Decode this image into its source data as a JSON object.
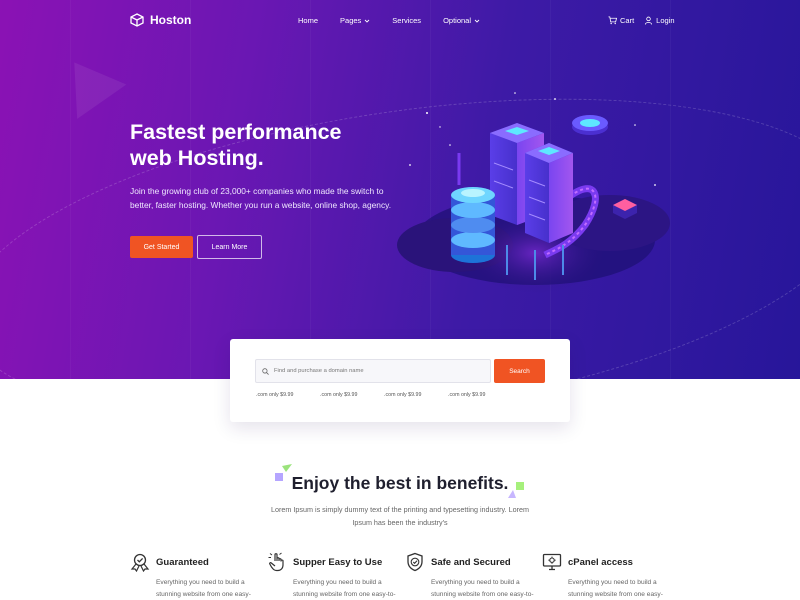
{
  "nav": {
    "logo": "Hoston",
    "menu": {
      "home": "Home",
      "pages": "Pages",
      "services": "Services",
      "optional": "Optional"
    },
    "cart": "Cart",
    "login": "Login"
  },
  "hero": {
    "title_line1": "Fastest performance",
    "title_line2": "web Hosting.",
    "subtitle": "Join the growing club of 23,000+ companies who made the switch to better, faster hosting. Whether you run a website, online shop, agency.",
    "primary_button": "Get Started",
    "secondary_button": "Learn More"
  },
  "search": {
    "placeholder": "Find and purchase a domain name",
    "button": "Search",
    "prices": [
      ".com only $9.99",
      ".com only $9.99",
      ".com only $9.99",
      ".com only $9.99"
    ]
  },
  "benefits": {
    "title": "Enjoy the best in benefits.",
    "subtitle": "Lorem Ipsum is simply dummy text of the printing and typesetting industry. Lorem Ipsum has been the industry's",
    "features": [
      {
        "title": "Guaranteed",
        "icon": "award-ribbon-icon",
        "desc": "Everything you need to build a stunning website from one easy-"
      },
      {
        "title": "Supper Easy to Use",
        "icon": "hand-pointer-icon",
        "desc": "Everything you need to build a stunning website from one easy-to-"
      },
      {
        "title": "Safe and Secured",
        "icon": "shield-check-icon",
        "desc": "Everything you need to build a stunning website from one easy-to-"
      },
      {
        "title": "cPanel access",
        "icon": "monitor-gear-icon",
        "desc": "Everything you need to build a stunning website from one easy-"
      }
    ]
  },
  "colors": {
    "accent": "#f05423",
    "hero_start": "#8b12b4",
    "hero_end": "#27169a"
  }
}
